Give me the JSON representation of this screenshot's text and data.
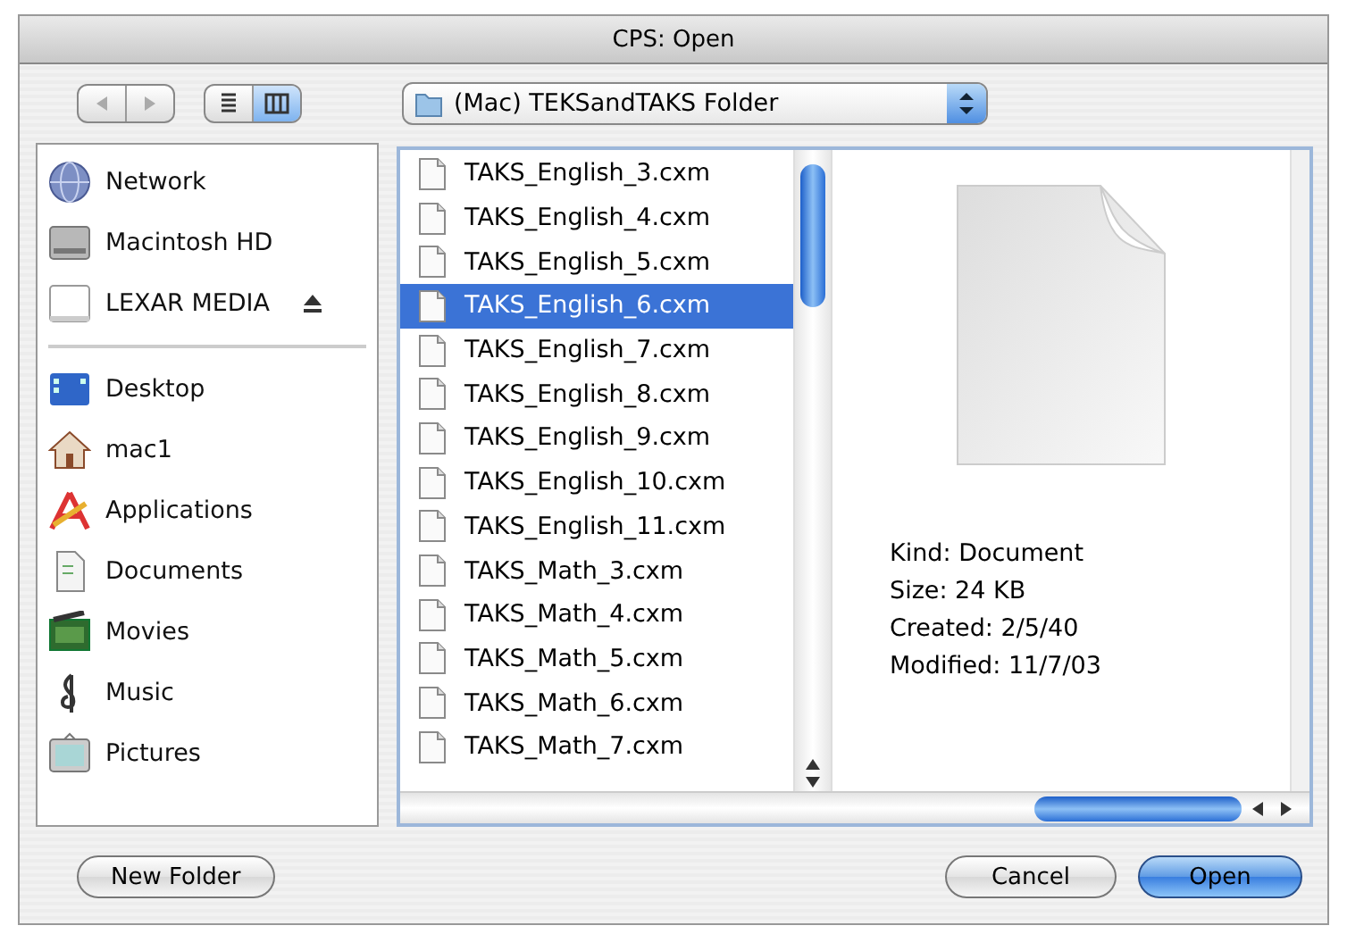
{
  "window": {
    "title": "CPS: Open"
  },
  "toolbar": {
    "view_modes": [
      {
        "kind": "list",
        "selected": false
      },
      {
        "kind": "column",
        "selected": true
      }
    ],
    "location": "(Mac) TEKSandTAKS Folder"
  },
  "sidebar": {
    "sections": [
      {
        "items": [
          {
            "label": "Network",
            "kind": "network",
            "ejectable": false
          },
          {
            "label": "Macintosh HD",
            "kind": "disk",
            "ejectable": false
          },
          {
            "label": "LEXAR MEDIA",
            "kind": "removable",
            "ejectable": true
          }
        ]
      },
      {
        "items": [
          {
            "label": "Desktop",
            "kind": "desktop",
            "ejectable": false
          },
          {
            "label": "mac1",
            "kind": "home",
            "ejectable": false
          },
          {
            "label": "Applications",
            "kind": "applications",
            "ejectable": false
          },
          {
            "label": "Documents",
            "kind": "documents",
            "ejectable": false
          },
          {
            "label": "Movies",
            "kind": "movies",
            "ejectable": false
          },
          {
            "label": "Music",
            "kind": "music",
            "ejectable": false
          },
          {
            "label": "Pictures",
            "kind": "pictures",
            "ejectable": false
          }
        ]
      }
    ]
  },
  "files": [
    {
      "name": "TAKS_English_3.cxm",
      "selected": false
    },
    {
      "name": "TAKS_English_4.cxm",
      "selected": false
    },
    {
      "name": "TAKS_English_5.cxm",
      "selected": false
    },
    {
      "name": "TAKS_English_6.cxm",
      "selected": true
    },
    {
      "name": "TAKS_English_7.cxm",
      "selected": false
    },
    {
      "name": "TAKS_English_8.cxm",
      "selected": false
    },
    {
      "name": "TAKS_English_9.cxm",
      "selected": false
    },
    {
      "name": "TAKS_English_10.cxm",
      "selected": false
    },
    {
      "name": "TAKS_English_11.cxm",
      "selected": false
    },
    {
      "name": "TAKS_Math_3.cxm",
      "selected": false
    },
    {
      "name": "TAKS_Math_4.cxm",
      "selected": false
    },
    {
      "name": "TAKS_Math_5.cxm",
      "selected": false
    },
    {
      "name": "TAKS_Math_6.cxm",
      "selected": false
    },
    {
      "name": "TAKS_Math_7.cxm",
      "selected": false
    }
  ],
  "preview": {
    "info": [
      "Kind: Document",
      "Size: 24 KB",
      "Created: 2/5/40",
      "Modified: 11/7/03"
    ]
  },
  "buttons": [
    {
      "label": "New Folder",
      "kind": "normal"
    },
    {
      "label": "Cancel",
      "kind": "normal"
    },
    {
      "label": "Open",
      "kind": "default"
    }
  ]
}
